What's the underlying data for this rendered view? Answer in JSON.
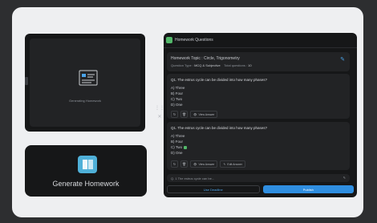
{
  "loading": {
    "text": "Generating Homework"
  },
  "generate_card": {
    "label": "Generate Homework",
    "icon": "book-icon"
  },
  "panel": {
    "title": "Homework Questions",
    "topic_line": "Homework Topic : Circle, Trigonometry",
    "question_type_label": "Question Type :",
    "question_type": "MCQ & Subjective",
    "total_questions_label": "Total questions :",
    "total_questions": "10",
    "questions": [
      {
        "title": "Q1. The estrus cycle can be divided into how many phases?",
        "options": [
          "A) Three",
          "B) Four",
          "C) Two",
          "D) One"
        ],
        "correct_index": -1,
        "actions": {
          "view_answer": "View Answer"
        }
      },
      {
        "title": "Q1. The estrus cycle can be divided into how many phases?",
        "options": [
          "A) Three",
          "B) Four",
          "C) Two",
          "D) One"
        ],
        "correct_index": 2,
        "actions": {
          "view_answer": "View Answer",
          "edit_answer": "Edit Answer"
        }
      }
    ],
    "partial_question": "Q. 1 The estrus cycle can be...",
    "footer": {
      "secondary": "Use Deadline",
      "primary": "Publish"
    }
  },
  "colors": {
    "accent": "#2f8ee0",
    "correct": "#53b86a",
    "logo": "#4fb0d8"
  }
}
